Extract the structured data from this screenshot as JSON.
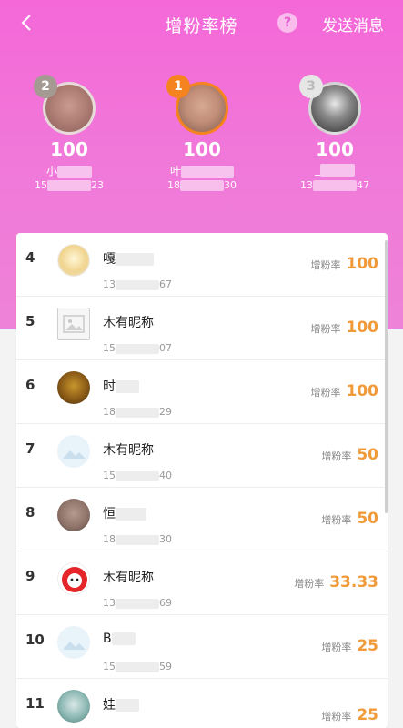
{
  "header": {
    "title": "增粉率榜",
    "help_icon": "question-icon",
    "help_label": "?",
    "send_label": "发送消息",
    "back_icon": "chevron-left-icon"
  },
  "top3": [
    {
      "rank": "2",
      "score": "100",
      "name": "小",
      "phone_start": "15",
      "phone_end": "23",
      "badge_color": "#a59a91"
    },
    {
      "rank": "1",
      "score": "100",
      "name": "叶",
      "phone_start": "18",
      "phone_end": "30",
      "badge_color": "#f5831f"
    },
    {
      "rank": "3",
      "score": "100",
      "name": "_",
      "phone_start": "13",
      "phone_end": "47",
      "badge_color": "#e6e6e6"
    }
  ],
  "rate_label": "增粉率",
  "rows": [
    {
      "rank": "4",
      "name": "嘎",
      "phone_start": "13",
      "phone_end": "67",
      "rate": "100"
    },
    {
      "rank": "5",
      "name": "木有昵称",
      "phone_start": "15",
      "phone_end": "07",
      "rate": "100"
    },
    {
      "rank": "6",
      "name": "时",
      "phone_start": "18",
      "phone_end": "29",
      "rate": "100"
    },
    {
      "rank": "7",
      "name": "木有昵称",
      "phone_start": "15",
      "phone_end": "40",
      "rate": "50"
    },
    {
      "rank": "8",
      "name": "恒",
      "phone_start": "18",
      "phone_end": "30",
      "rate": "50"
    },
    {
      "rank": "9",
      "name": "木有昵称",
      "phone_start": "13",
      "phone_end": "69",
      "rate": "33.33"
    },
    {
      "rank": "10",
      "name": "B",
      "phone_start": "15",
      "phone_end": "59",
      "rate": "25"
    },
    {
      "rank": "11",
      "name": "娃",
      "phone_start": "",
      "phone_end": "",
      "rate": "25"
    }
  ],
  "colors": {
    "accent": "#f468d8",
    "rate_value": "#f09a3a"
  }
}
